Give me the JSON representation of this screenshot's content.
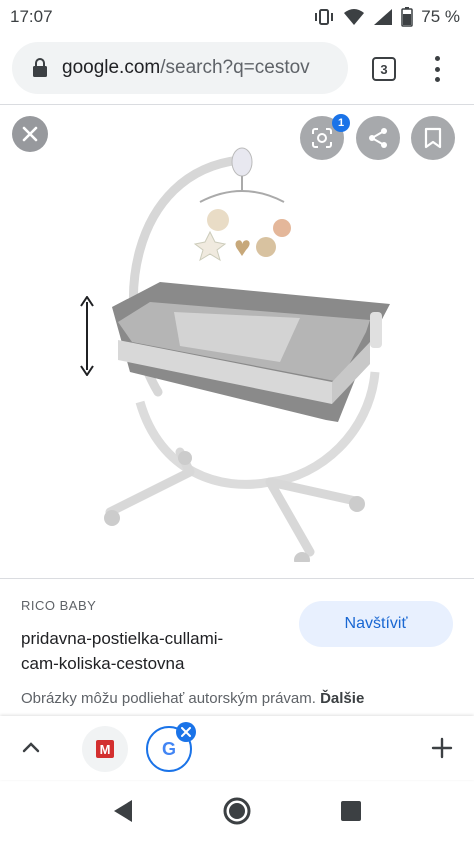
{
  "status_bar": {
    "time": "17:07",
    "battery": "75 %"
  },
  "browser": {
    "url_domain": "google.com",
    "url_path": "/search?q=cestov",
    "tab_count": "3"
  },
  "image_viewer": {
    "lens_badge_count": "1",
    "icons": [
      "close-icon",
      "lens-icon",
      "share-icon",
      "bookmark-icon"
    ]
  },
  "result": {
    "source": "RICO BABY",
    "title": "pridavna-postielka-cullami-cam-koliska-cestovna",
    "title_line1": "pridavna-postielka-cullami-",
    "title_line2": "cam-koliska-cestovna",
    "visit_label": "Navštíviť",
    "copyright_text": "Obrázky môžu podliehať autorským právam.",
    "more_label": "Ďalšie"
  },
  "tab_strip": {
    "m_tab_letter": "M",
    "g_tab_letter": "G"
  },
  "colors": {
    "accent": "#1a73e8",
    "visit_bg": "#e8f0fe",
    "bassinet_gray": "#8a8a8a"
  }
}
